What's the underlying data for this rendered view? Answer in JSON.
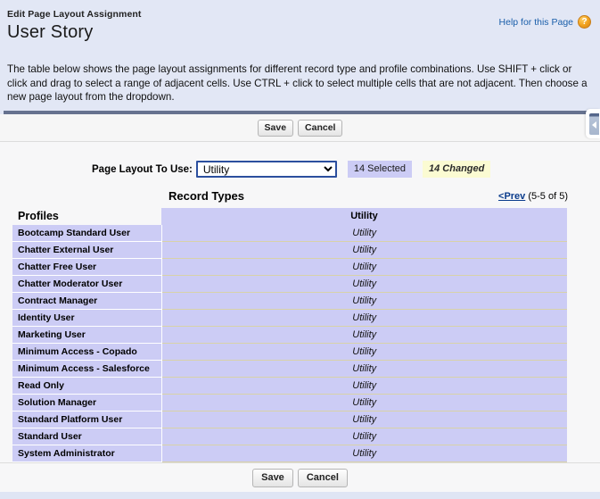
{
  "header": {
    "eyebrow": "Edit Page Layout Assignment",
    "title": "User Story",
    "help_label": "Help for this Page",
    "help_icon": "question-mark-circle-icon",
    "intro": "The table below shows the page layout assignments for different record type and profile combinations. Use SHIFT + click or click and drag to select a range of adjacent cells. Use CTRL + click to select multiple cells that are not adjacent. Then choose a new page layout from the dropdown."
  },
  "toolbar_top": {
    "save_label": "Save",
    "cancel_label": "Cancel",
    "collapse_icon": "chevron-left-icon"
  },
  "layout_control": {
    "label": "Page Layout To Use:",
    "selected_value": "Utility",
    "options": [
      "Utility"
    ],
    "selected_badge": "14 Selected",
    "changed_badge": "14 Changed",
    "selected_badge_color": "#ccccf5",
    "changed_badge_color": "#fbfbd2",
    "focus_border_color": "#2b4f9e"
  },
  "table": {
    "record_types_title": "Record Types",
    "pager": {
      "prev_label": "<Prev",
      "range_label": "(5-5 of 5)"
    },
    "profiles_header": "Profiles",
    "columns": [
      "Utility"
    ],
    "rows": [
      {
        "profile": "Bootcamp Standard User",
        "layout": "Utility"
      },
      {
        "profile": "Chatter External User",
        "layout": "Utility"
      },
      {
        "profile": "Chatter Free User",
        "layout": "Utility"
      },
      {
        "profile": "Chatter Moderator User",
        "layout": "Utility"
      },
      {
        "profile": "Contract Manager",
        "layout": "Utility"
      },
      {
        "profile": "Identity User",
        "layout": "Utility"
      },
      {
        "profile": "Marketing User",
        "layout": "Utility"
      },
      {
        "profile": "Minimum Access - Copado",
        "layout": "Utility"
      },
      {
        "profile": "Minimum Access - Salesforce",
        "layout": "Utility"
      },
      {
        "profile": "Read Only",
        "layout": "Utility"
      },
      {
        "profile": "Solution Manager",
        "layout": "Utility"
      },
      {
        "profile": "Standard Platform User",
        "layout": "Utility"
      },
      {
        "profile": "Standard User",
        "layout": "Utility"
      },
      {
        "profile": "System Administrator",
        "layout": "Utility"
      }
    ],
    "cell_selected_color": "#ccccf5"
  },
  "toolbar_bottom": {
    "save_label": "Save",
    "cancel_label": "Cancel"
  }
}
